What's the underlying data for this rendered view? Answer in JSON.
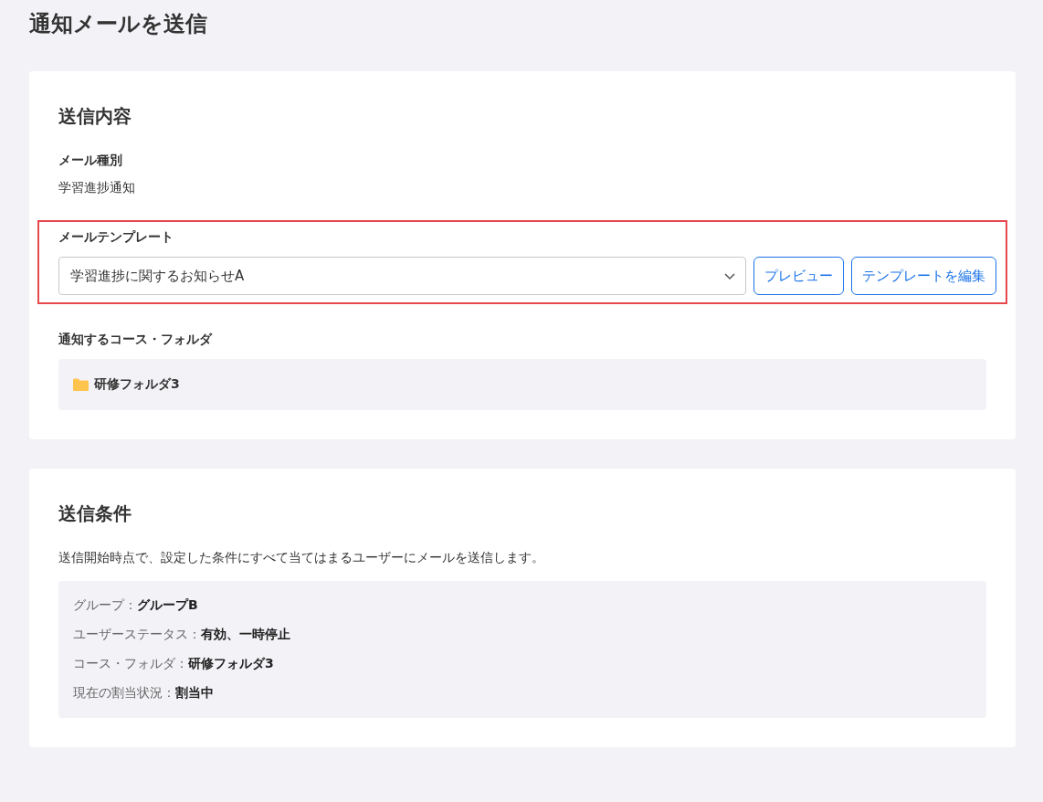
{
  "page_title": "通知メールを送信",
  "content_card": {
    "title": "送信内容",
    "mail_type": {
      "label": "メール種別",
      "value": "学習進捗通知"
    },
    "template": {
      "label": "メールテンプレート",
      "highlighted": true,
      "value": "学習進捗に関するお知らせA",
      "buttons": [
        "プレビュー",
        "テンプレートを編集"
      ]
    },
    "target": {
      "label": "通知するコース・フォルダ",
      "folder": "研修フォルダ3"
    }
  },
  "conditions_card": {
    "title": "送信条件",
    "description": "送信開始時点で、設定した条件にすべて当てはまるユーザーにメールを送信します。",
    "conditions": [
      {
        "label": "グループ：",
        "value": "グループB"
      },
      {
        "label": "ユーザーステータス：",
        "value": "有効、一時停止"
      },
      {
        "label": "コース・フォルダ：",
        "value": "研修フォルダ3"
      },
      {
        "label": "現在の割当状況：",
        "value": "割当中"
      }
    ]
  }
}
